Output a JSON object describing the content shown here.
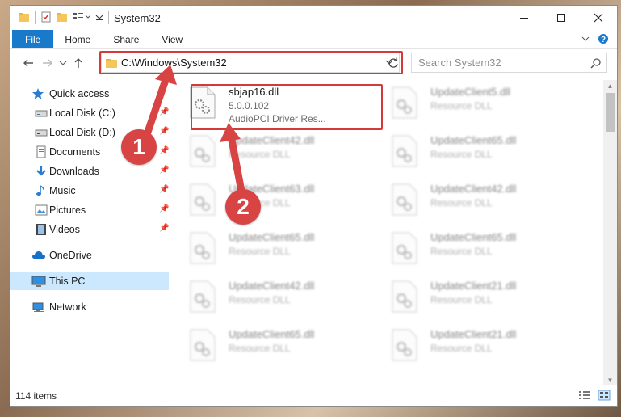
{
  "window": {
    "title": "System32"
  },
  "ribbon": {
    "tabs": [
      "File",
      "Home",
      "Share",
      "View"
    ]
  },
  "address": {
    "path": "C:\\Windows\\System32"
  },
  "search": {
    "placeholder": "Search System32"
  },
  "sidebar": {
    "quick_access": "Quick access",
    "items": [
      {
        "label": "Local Disk (C:)",
        "icon": "drive-icon",
        "pinned": true
      },
      {
        "label": "Local Disk (D:)",
        "icon": "drive-icon",
        "pinned": true
      },
      {
        "label": "Documents",
        "icon": "documents-icon",
        "pinned": true
      },
      {
        "label": "Downloads",
        "icon": "downloads-icon",
        "pinned": true
      },
      {
        "label": "Music",
        "icon": "music-icon",
        "pinned": true
      },
      {
        "label": "Pictures",
        "icon": "pictures-icon",
        "pinned": true
      },
      {
        "label": "Videos",
        "icon": "videos-icon",
        "pinned": true
      }
    ],
    "onedrive": "OneDrive",
    "this_pc": "This PC",
    "network": "Network"
  },
  "files": [
    {
      "name": "sbjap16.dll",
      "version": "5.0.0.102",
      "desc": "AudioPCI Driver Res..."
    },
    {
      "name": "UpdateClient5.dll",
      "desc": "Resource DLL"
    },
    {
      "name": "UpdateClient42.dll",
      "desc": "Resource DLL"
    },
    {
      "name": "UpdateClient65.dll",
      "desc": "Resource DLL"
    },
    {
      "name": "UpdateClient63.dll",
      "desc": "Resource DLL"
    },
    {
      "name": "UpdateClient42.dll",
      "desc": "Resource DLL"
    },
    {
      "name": "UpdateClient65.dll",
      "desc": "Resource DLL"
    },
    {
      "name": "UpdateClient65.dll",
      "desc": "Resource DLL"
    },
    {
      "name": "UpdateClient42.dll",
      "desc": "Resource DLL"
    },
    {
      "name": "UpdateClient21.dll",
      "desc": "Resource DLL"
    },
    {
      "name": "UpdateClient65.dll",
      "desc": "Resource DLL"
    },
    {
      "name": "UpdateClient21.dll",
      "desc": "Resource DLL"
    }
  ],
  "status": {
    "item_count": "114 items"
  },
  "callouts": [
    "1",
    "2"
  ],
  "colors": {
    "accent": "#1979ca",
    "selected": "#cce8ff",
    "annotation": "#d33b3b"
  }
}
